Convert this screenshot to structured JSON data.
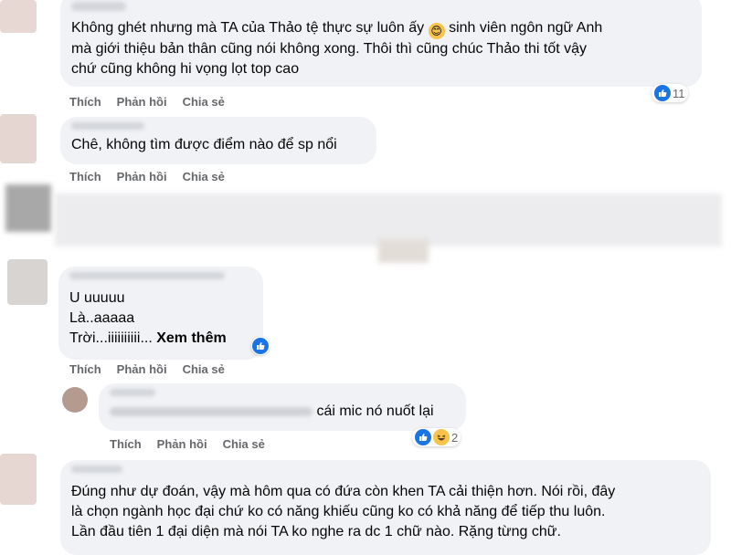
{
  "actions": {
    "like": "Thích",
    "reply": "Phản hồi",
    "share": "Chia sẻ"
  },
  "comments": [
    {
      "lines": [
        "Không ghét nhưng mà TA của Thảo tệ thực sự luôn ấy",
        "sinh viên ngôn ngữ Anh",
        "mà giới thiệu bản thân cũng nói không xong. Thôi thì cũng chúc Thảo thi tốt vậy",
        "chứ cũng không hi vọng lọt top cao"
      ],
      "emoji": "😊",
      "reaction_count": "11"
    },
    {
      "lines": [
        "Chê, không tìm được điểm nào để sp nổi"
      ]
    },
    {
      "lines": [
        "U uuuuu",
        "Là..aaaaa",
        "Trời...iiiiiiiiii..."
      ],
      "see_more": "Xem thêm"
    },
    {
      "line_tail": "cái mic nó nuốt lại",
      "reaction_count": "2"
    },
    {
      "lines": [
        "Đúng như dự đoán, vậy mà hôm qua có đứa còn khen TA cải thiện hơn. Nói rồi, đây",
        "là chọn ngành học đại chứ ko có năng khiếu cũng ko có khả năng để tiếp thu luôn.",
        "Lần đầu tiên 1 đại diện mà nói TA ko nghe ra dc 1 chữ nào. Rặng từng chữ."
      ]
    }
  ],
  "icons": {
    "like": "like-icon",
    "haha": "haha-icon"
  },
  "colors": {
    "bubble": "#f0f2f5",
    "like_blue": "#1b74e4",
    "action_gray": "#65676b"
  }
}
